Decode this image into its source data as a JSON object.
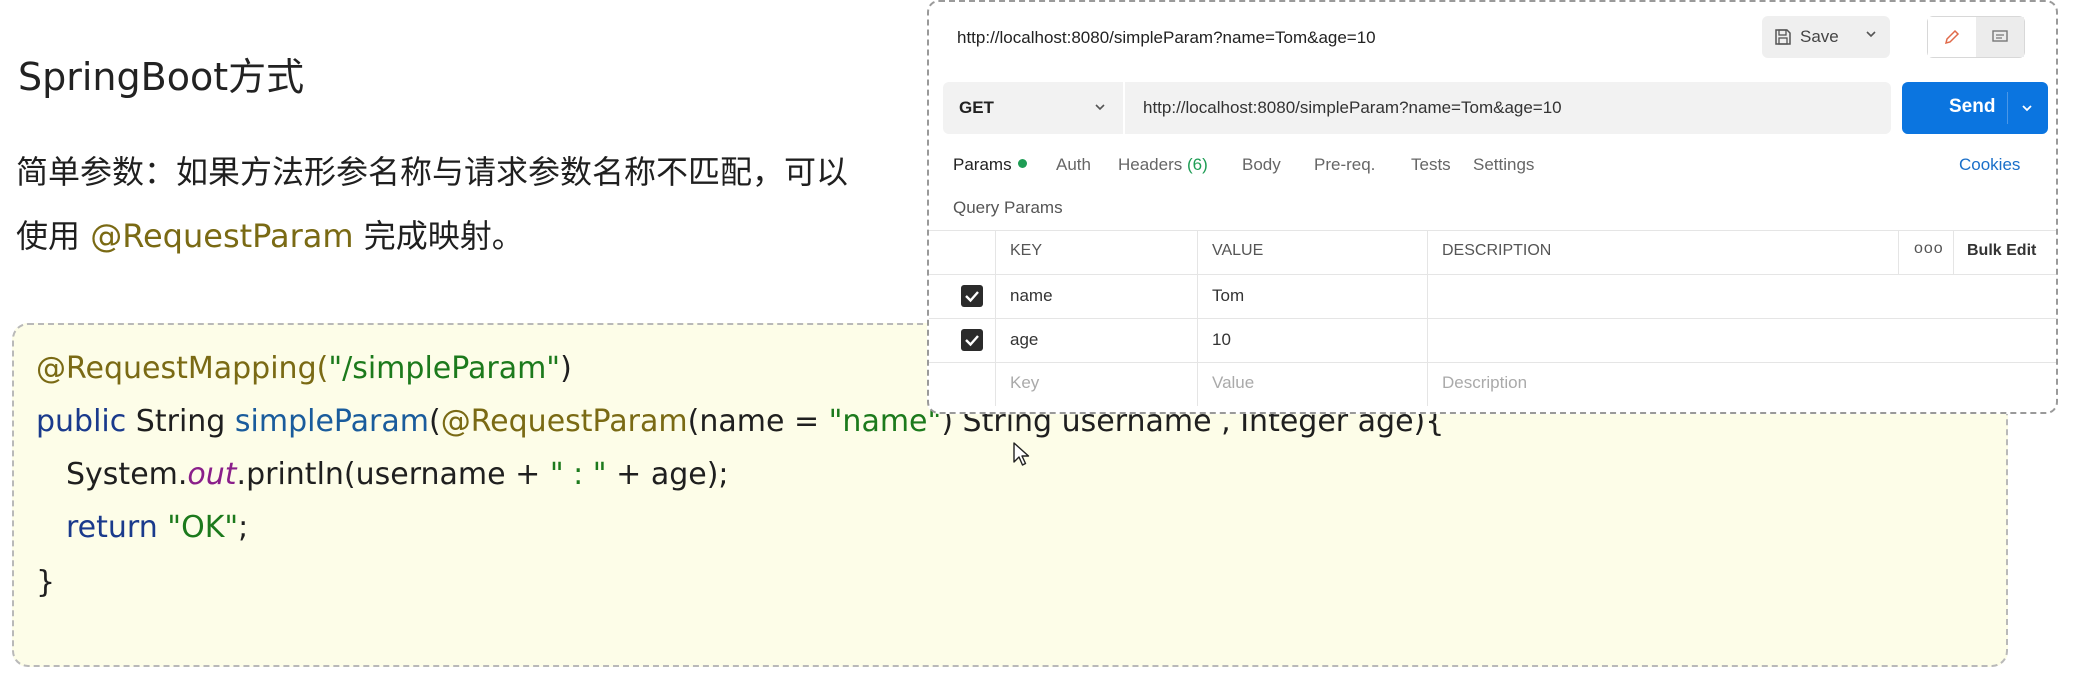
{
  "slide": {
    "heading": "SpringBoot方式",
    "desc_line1": "简单参数：如果方法形参名称与请求参数名称不匹配，可以",
    "desc_line2_prefix": "使用 ",
    "desc_line2_highlight": "@RequestParam",
    "desc_line2_suffix": " 完成映射。"
  },
  "code": {
    "line1": {
      "ann": "@RequestMapping(",
      "str": "\"/simpleParam\"",
      "tail": ")"
    },
    "line2": {
      "kw": "public",
      "t1": " String ",
      "fn": "simpleParam",
      "t2": "(",
      "ann": "@RequestParam",
      "t3": "(name = ",
      "str": "\"name\"",
      "t4": ") String username , Integer age){"
    },
    "line3": {
      "t1": "System.",
      "field": "out",
      "t2": ".println(username + ",
      "str": "\" : \"",
      "t3": " + age);"
    },
    "line4": {
      "kw": "return",
      "sp": " ",
      "str": "\"OK\"",
      "tail": ";"
    },
    "line5": "}"
  },
  "postman": {
    "title": "http://localhost:8080/simpleParam?name=Tom&age=10",
    "save_label": "Save",
    "method": "GET",
    "url": "http://localhost:8080/simpleParam?name=Tom&age=10",
    "send_label": "Send",
    "tabs": {
      "params": "Params",
      "auth": "Auth",
      "headers": "Headers",
      "headers_count": "(6)",
      "body": "Body",
      "prereq": "Pre-req.",
      "tests": "Tests",
      "settings": "Settings"
    },
    "cookies": "Cookies",
    "query_params_title": "Query Params",
    "columns": {
      "key": "KEY",
      "value": "VALUE",
      "description": "DESCRIPTION",
      "more": "ooo",
      "bulk_edit": "Bulk Edit"
    },
    "rows": [
      {
        "key": "name",
        "value": "Tom",
        "checked": true
      },
      {
        "key": "age",
        "value": "10",
        "checked": true
      }
    ],
    "placeholder": {
      "key": "Key",
      "value": "Value",
      "description": "Description"
    }
  },
  "colors": {
    "send_button": "#0b75e0",
    "code_background": "#fdfde8",
    "annotation": "#7a6a14",
    "string": "#1c7a1c"
  }
}
